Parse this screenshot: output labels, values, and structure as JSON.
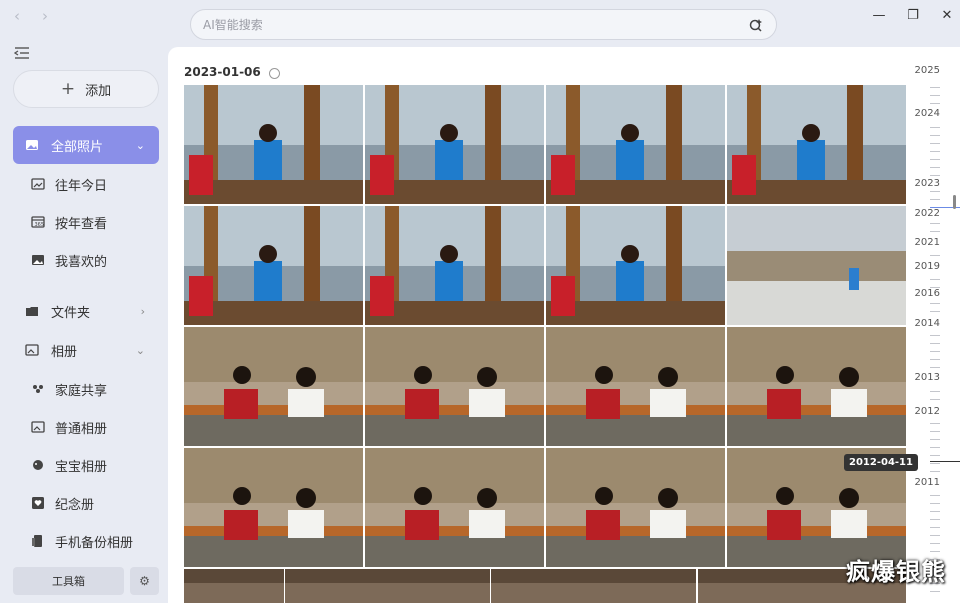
{
  "search": {
    "placeholder": "AI智能搜索"
  },
  "sidebar": {
    "add_label": "添加",
    "items": [
      {
        "label": "全部照片",
        "icon": "photo-icon"
      },
      {
        "label": "往年今日",
        "icon": "calendar-photo-icon"
      },
      {
        "label": "按年查看",
        "icon": "calendar-icon"
      },
      {
        "label": "我喜欢的",
        "icon": "image-icon"
      },
      {
        "label": "文件夹",
        "icon": "folder-icon"
      },
      {
        "label": "相册",
        "icon": "album-icon"
      },
      {
        "label": "家庭共享",
        "icon": "family-icon"
      },
      {
        "label": "普通相册",
        "icon": "album-icon"
      },
      {
        "label": "宝宝相册",
        "icon": "baby-icon"
      },
      {
        "label": "纪念册",
        "icon": "heart-book-icon"
      },
      {
        "label": "手机备份相册",
        "icon": "phone-backup-icon"
      }
    ],
    "toolbox_label": "工具箱"
  },
  "main": {
    "date_header": "2023-01-06"
  },
  "timeline": {
    "years": [
      "2025",
      "2024",
      "2023",
      "2022",
      "2021",
      "2019",
      "2016",
      "2014",
      "2013",
      "2012",
      "2011"
    ],
    "hover_date": "2012-04-11"
  },
  "watermark": "疯爆银熊",
  "colors": {
    "accent": "#8a8fe8",
    "active_tick": "#6b8be6"
  }
}
